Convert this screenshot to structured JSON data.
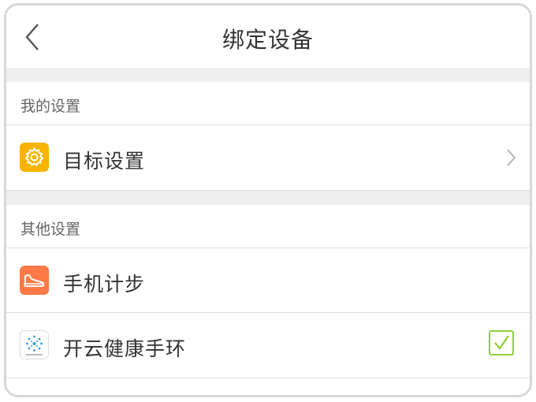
{
  "header": {
    "title": "绑定设备"
  },
  "sections": [
    {
      "label": "我的设置",
      "items": [
        {
          "label": "目标设置",
          "icon": "gear-icon",
          "color": "#f8b400"
        }
      ]
    },
    {
      "label": "其他设置",
      "items": [
        {
          "label": "手机计步",
          "icon": "sneaker-icon",
          "color": "#ff7a45"
        },
        {
          "label": "开云健康手环",
          "icon": "band-logo-icon",
          "checked": true
        }
      ]
    }
  ],
  "colors": {
    "check": "#8fcf3a",
    "divider": "#dddddd",
    "gap": "#eeeeee"
  }
}
